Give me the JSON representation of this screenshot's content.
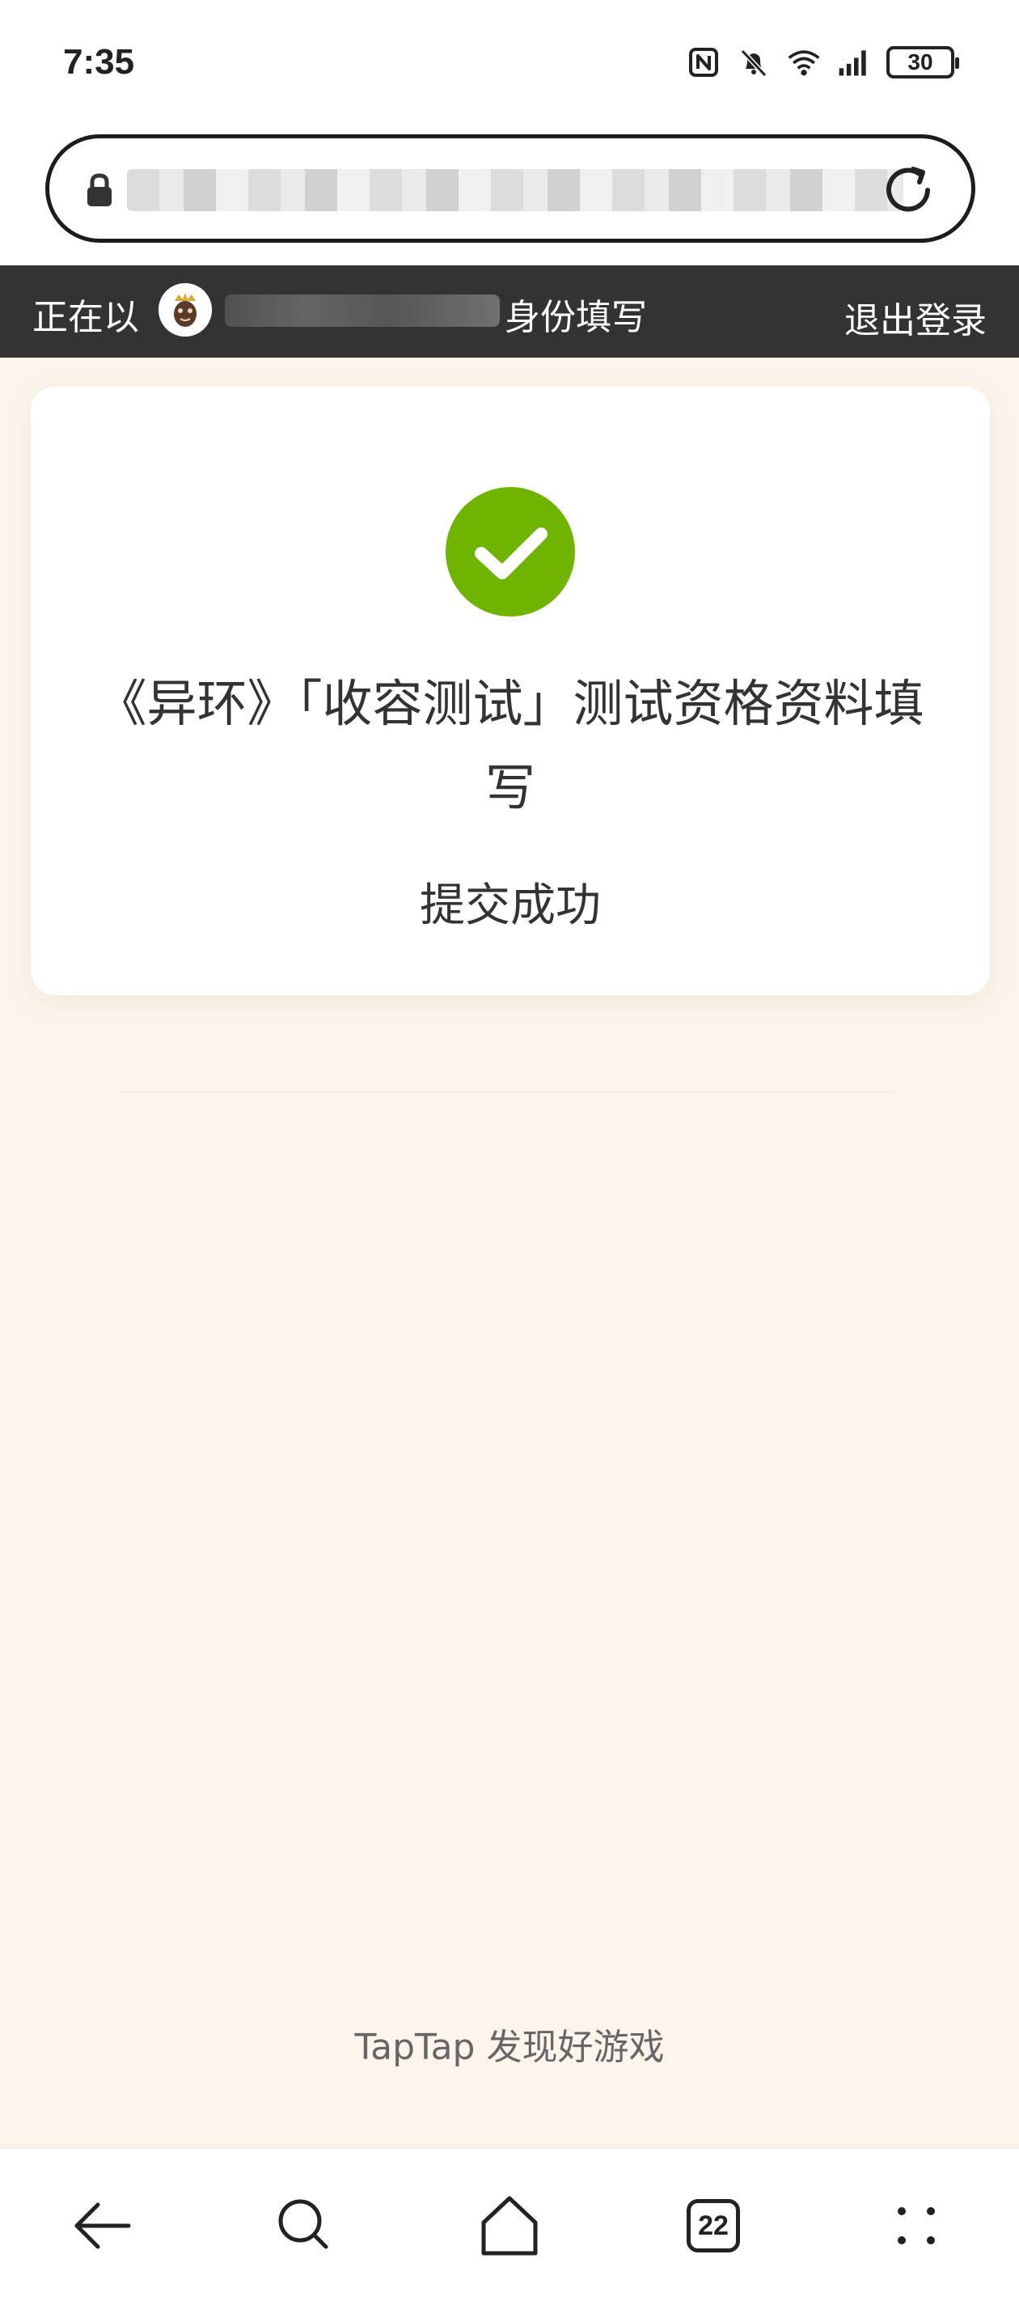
{
  "status_bar": {
    "time": "7:35",
    "battery": "30",
    "icons": [
      "nfc-icon",
      "bell-muted-icon",
      "wifi-icon",
      "signal-icon",
      "battery-icon"
    ]
  },
  "url_bar": {
    "url": "",
    "icons": [
      "lock-icon",
      "reload-icon"
    ]
  },
  "identity_bar": {
    "prefix": "正在以",
    "suffix": "身份填写",
    "logout_label": "退出登录"
  },
  "card": {
    "title": "《异环》「收容测试」测试资格资料填写",
    "status": "提交成功",
    "icon": "check-circle-icon",
    "accent_color": "#6fb500"
  },
  "footer": {
    "slogan": "TapTap 发现好游戏"
  },
  "bottom_nav": {
    "tab_count": "22",
    "items": [
      "back-icon",
      "search-icon",
      "home-icon",
      "tabs-icon",
      "more-icon"
    ]
  },
  "colors": {
    "identity_bar_bg": "#333333",
    "page_bg": "#fdf5ec"
  }
}
